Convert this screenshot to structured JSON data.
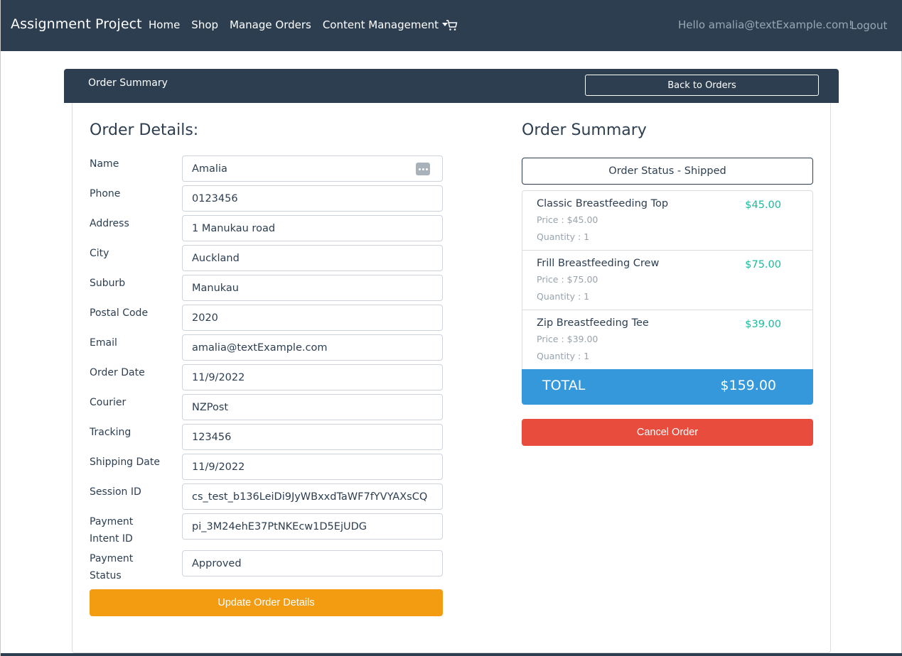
{
  "navbar": {
    "brand": "Assignment Project",
    "links": [
      "Home",
      "Shop",
      "Manage Orders",
      "Content Management"
    ],
    "cart_icon": "cart-icon",
    "greeting": "Hello amalia@textExample.com!",
    "logout": "Logout"
  },
  "header": {
    "title": "Order Summary",
    "back_button": "Back to Orders"
  },
  "details": {
    "heading": "Order Details:",
    "fields": [
      {
        "label": "Name",
        "value": "Amalia"
      },
      {
        "label": "Phone",
        "value": "0123456"
      },
      {
        "label": "Address",
        "value": "1 Manukau road"
      },
      {
        "label": "City",
        "value": "Auckland"
      },
      {
        "label": "Suburb",
        "value": "Manukau"
      },
      {
        "label": "Postal Code",
        "value": "2020"
      },
      {
        "label": "Email",
        "value": "amalia@textExample.com"
      },
      {
        "label": "Order Date",
        "value": "11/9/2022"
      },
      {
        "label": "Courier",
        "value": "NZPost"
      },
      {
        "label": "Tracking",
        "value": "123456"
      },
      {
        "label": "Shipping Date",
        "value": "11/9/2022"
      },
      {
        "label": "Session ID",
        "value": "cs_test_b136LeiDi9JyWBxxdTaWF7fYVYAXsCQ"
      },
      {
        "label": "Payment Intent ID",
        "value": "pi_3M24ehE37PtNKEcw1D5EjUDG"
      },
      {
        "label": "Payment Status",
        "value": "Approved"
      }
    ],
    "update_button": "Update Order Details"
  },
  "summary": {
    "heading": "Order Summary",
    "status": "Order Status - Shipped",
    "items": [
      {
        "name": "Classic Breastfeeding Top",
        "price": "Price : $45.00",
        "quantity": "Quantity : 1",
        "amount": "$45.00"
      },
      {
        "name": "Frill Breastfeeding Crew",
        "price": "Price : $75.00",
        "quantity": "Quantity : 1",
        "amount": "$75.00"
      },
      {
        "name": "Zip Breastfeeding Tee",
        "price": "Price : $39.00",
        "quantity": "Quantity : 1",
        "amount": "$39.00"
      }
    ],
    "total_label": "TOTAL",
    "total_value": "$159.00",
    "cancel_button": "Cancel Order"
  },
  "colors": {
    "navbar": "#2c3e50",
    "warning": "#f39c12",
    "danger": "#e74c3c",
    "info": "#3498db",
    "success": "#18bc9c"
  }
}
